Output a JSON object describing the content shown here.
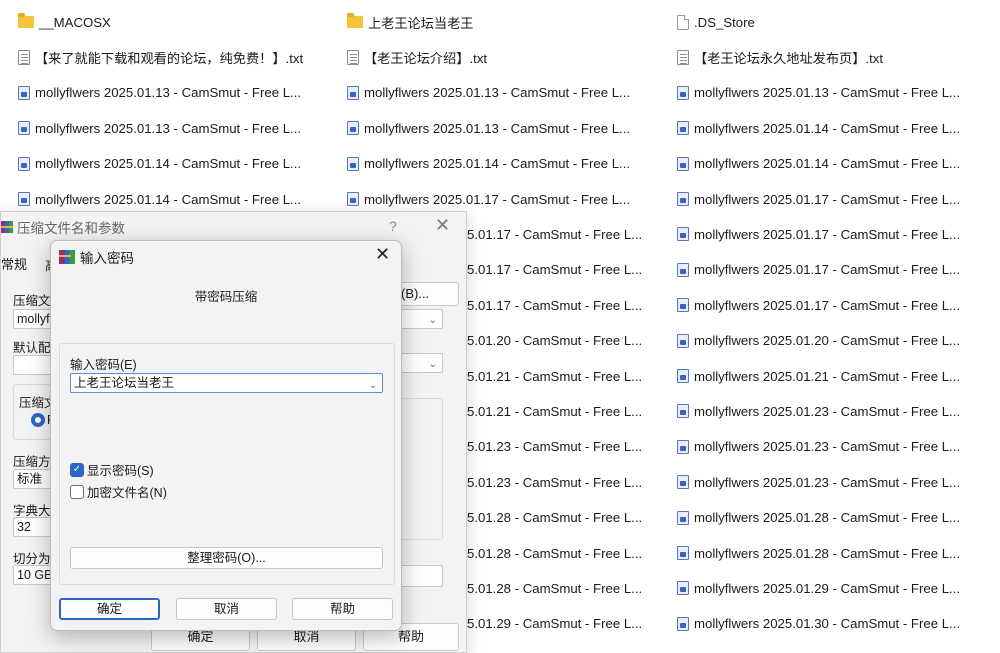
{
  "explorer": {
    "columns": [
      [
        {
          "name": "__MACOSX",
          "icon": "folder-icon"
        },
        {
          "name": "【来了就能下载和观看的论坛，纯免费！】.txt",
          "icon": "text-file-icon"
        },
        {
          "name": "mollyflwers 2025.01.13 - CamSmut - Free L...",
          "icon": "html-file-icon"
        },
        {
          "name": "mollyflwers 2025.01.13 - CamSmut - Free L...",
          "icon": "html-file-icon"
        },
        {
          "name": "mollyflwers 2025.01.14 - CamSmut - Free L...",
          "icon": "html-file-icon"
        },
        {
          "name": "mollyflwers 2025.01.14 - CamSmut - Free L...",
          "icon": "html-file-icon"
        }
      ],
      [
        {
          "name": "上老王论坛当老王",
          "icon": "folder-icon"
        },
        {
          "name": "【老王论坛介绍】.txt",
          "icon": "text-file-icon"
        },
        {
          "name": "mollyflwers 2025.01.13 - CamSmut - Free L...",
          "icon": "html-file-icon"
        },
        {
          "name": "mollyflwers 2025.01.13 - CamSmut - Free L...",
          "icon": "html-file-icon"
        },
        {
          "name": "mollyflwers 2025.01.14 - CamSmut - Free L...",
          "icon": "html-file-icon"
        },
        {
          "name": "mollyflwers 2025.01.17 - CamSmut - Free L...",
          "icon": "html-file-icon"
        },
        {
          "name": "5.01.17 - CamSmut - Free L...",
          "icon": "none"
        },
        {
          "name": "5.01.17 - CamSmut - Free L...",
          "icon": "none"
        },
        {
          "name": "5.01.17 - CamSmut - Free L...",
          "icon": "none"
        },
        {
          "name": "5.01.20 - CamSmut - Free L...",
          "icon": "none"
        },
        {
          "name": "5.01.21 - CamSmut - Free L...",
          "icon": "none"
        },
        {
          "name": "5.01.21 - CamSmut - Free L...",
          "icon": "none"
        },
        {
          "name": "5.01.23 - CamSmut - Free L...",
          "icon": "none"
        },
        {
          "name": "5.01.23 - CamSmut - Free L...",
          "icon": "none"
        },
        {
          "name": "5.01.28 - CamSmut - Free L...",
          "icon": "none"
        },
        {
          "name": "5.01.28 - CamSmut - Free L...",
          "icon": "none"
        },
        {
          "name": "5.01.28 - CamSmut - Free L...",
          "icon": "none"
        },
        {
          "name": "5.01.29 - CamSmut - Free L...",
          "icon": "none"
        }
      ],
      [
        {
          "name": ".DS_Store",
          "icon": "blank-file-icon"
        },
        {
          "name": "【老王论坛永久地址发布页】.txt",
          "icon": "text-file-icon"
        },
        {
          "name": "mollyflwers 2025.01.13 - CamSmut - Free L...",
          "icon": "html-file-icon"
        },
        {
          "name": "mollyflwers 2025.01.14 - CamSmut - Free L...",
          "icon": "html-file-icon"
        },
        {
          "name": "mollyflwers 2025.01.14 - CamSmut - Free L...",
          "icon": "html-file-icon"
        },
        {
          "name": "mollyflwers 2025.01.17 - CamSmut - Free L...",
          "icon": "html-file-icon"
        },
        {
          "name": "mollyflwers 2025.01.17 - CamSmut - Free L...",
          "icon": "html-file-icon"
        },
        {
          "name": "mollyflwers 2025.01.17 - CamSmut - Free L...",
          "icon": "html-file-icon"
        },
        {
          "name": "mollyflwers 2025.01.17 - CamSmut - Free L...",
          "icon": "html-file-icon"
        },
        {
          "name": "mollyflwers 2025.01.20 - CamSmut - Free L...",
          "icon": "html-file-icon"
        },
        {
          "name": "mollyflwers 2025.01.21 - CamSmut - Free L...",
          "icon": "html-file-icon"
        },
        {
          "name": "mollyflwers 2025.01.23 - CamSmut - Free L...",
          "icon": "html-file-icon"
        },
        {
          "name": "mollyflwers 2025.01.23 - CamSmut - Free L...",
          "icon": "html-file-icon"
        },
        {
          "name": "mollyflwers 2025.01.23 - CamSmut - Free L...",
          "icon": "html-file-icon"
        },
        {
          "name": "mollyflwers 2025.01.28 - CamSmut - Free L...",
          "icon": "html-file-icon"
        },
        {
          "name": "mollyflwers 2025.01.28 - CamSmut - Free L...",
          "icon": "html-file-icon"
        },
        {
          "name": "mollyflwers 2025.01.29 - CamSmut - Free L...",
          "icon": "html-file-icon"
        },
        {
          "name": "mollyflwers 2025.01.30 - CamSmut - Free L...",
          "icon": "html-file-icon"
        }
      ]
    ]
  },
  "archive_dialog": {
    "title": "压缩文件名和参数",
    "help_glyph": "?",
    "close_glyph": "✕",
    "tab_general": "常规",
    "tab_advanced_partial": "高",
    "archive_name_label": "压缩文件",
    "archive_name_value": "mollyfl",
    "browse_button": "(B)...",
    "default_profile_label": "默认配置",
    "archive_format_label": "压缩文",
    "compression_method_label": "压缩方",
    "compression_method_value": "标准",
    "dictionary_size_label": "字典大小",
    "dictionary_size_value": "32",
    "split_label": "切分为分",
    "split_value": "10 GB",
    "ok_button": "确定",
    "cancel_button": "取消",
    "help_button": "帮助"
  },
  "password_dialog": {
    "title": "输入密码",
    "close_glyph": "✕",
    "subtitle": "带密码压缩",
    "password_label": "输入密码(E)",
    "password_value": "上老王论坛当老王",
    "show_password_label": "显示密码(S)",
    "show_password_checked": true,
    "encrypt_filenames_label": "加密文件名(N)",
    "encrypt_filenames_checked": false,
    "organize_button": "整理密码(O)...",
    "ok_button": "确定",
    "cancel_button": "取消",
    "help_button": "帮助"
  },
  "colors": {
    "accent": "#2a66c6",
    "folder": "#f4c33c",
    "dialog_bg": "#f3f3f3"
  }
}
